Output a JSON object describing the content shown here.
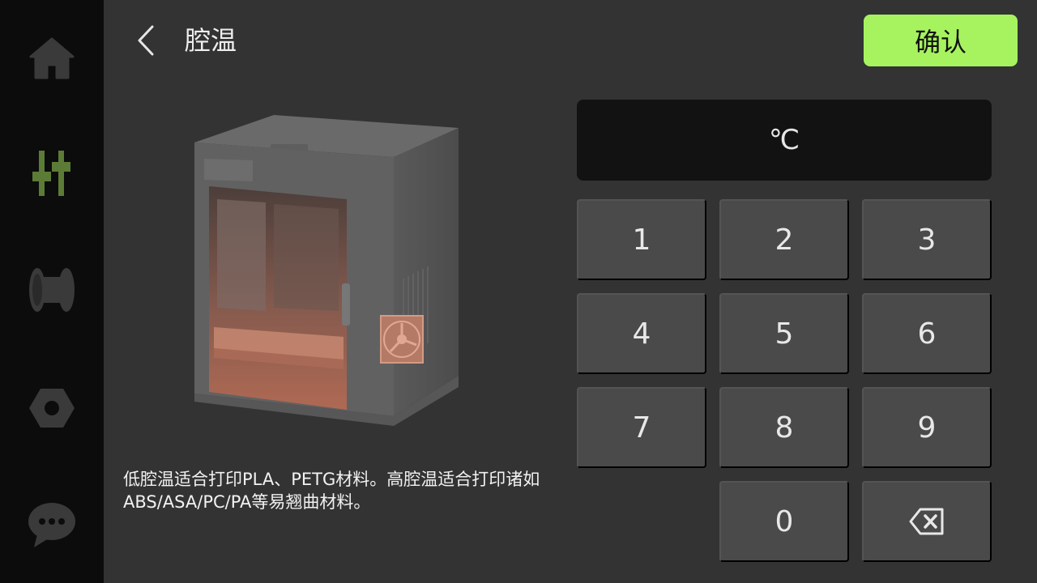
{
  "sidebar": {
    "items": [
      {
        "icon": "home-icon",
        "active": false
      },
      {
        "icon": "controls-icon",
        "active": true
      },
      {
        "icon": "filament-spool-icon",
        "active": false
      },
      {
        "icon": "settings-nut-icon",
        "active": false
      },
      {
        "icon": "chat-icon",
        "active": false
      }
    ],
    "active_color": "#5b7b36",
    "inactive_color": "#3a3a3a"
  },
  "header": {
    "back_icon": "chevron-left-icon",
    "title": "腔温",
    "confirm_label": "确认",
    "confirm_color": "#a6f35f"
  },
  "illustration": {
    "subject": "3d-printer-chamber-illustration"
  },
  "description": {
    "text": "低腔温适合打印PLA、PETG材料。高腔温适合打印诸如ABS/ASA/PC/PA等易翘曲材料。"
  },
  "input": {
    "value": "",
    "unit": "℃"
  },
  "keypad": {
    "keys": [
      "1",
      "2",
      "3",
      "4",
      "5",
      "6",
      "7",
      "8",
      "9",
      "0"
    ],
    "backspace_icon": "backspace-icon"
  }
}
